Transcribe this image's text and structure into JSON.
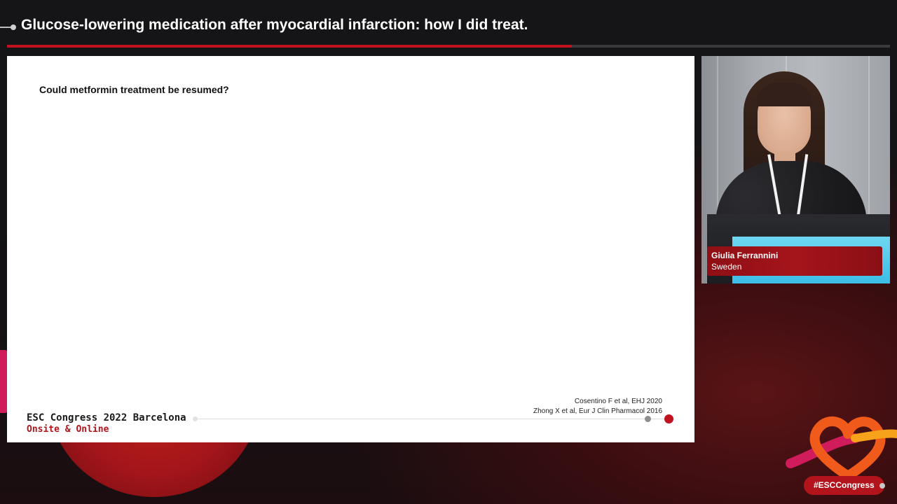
{
  "header": {
    "title": "Glucose-lowering medication after myocardial infarction: how I did treat.",
    "progress_fraction": 0.64
  },
  "slide": {
    "question": "Could metformin treatment be resumed?",
    "references": [
      "Cosentino F et al, EHJ 2020",
      "Zhong X et al, Eur J Clin Pharmacol 2016"
    ],
    "brand_line1": "ESC Congress 2022 Barcelona",
    "brand_line2": "Onsite & Online"
  },
  "speaker": {
    "name": "Giulia Ferrannini",
    "country": "Sweden"
  },
  "social": {
    "hashtag": "#ESCCongress"
  },
  "colors": {
    "brand_red": "#c1121f",
    "slide_bg": "#ffffff",
    "stage_bg": "#151517"
  },
  "icons": {
    "header_marker": "timeline-dot-icon",
    "logo": "esc-heart-logo-icon"
  }
}
